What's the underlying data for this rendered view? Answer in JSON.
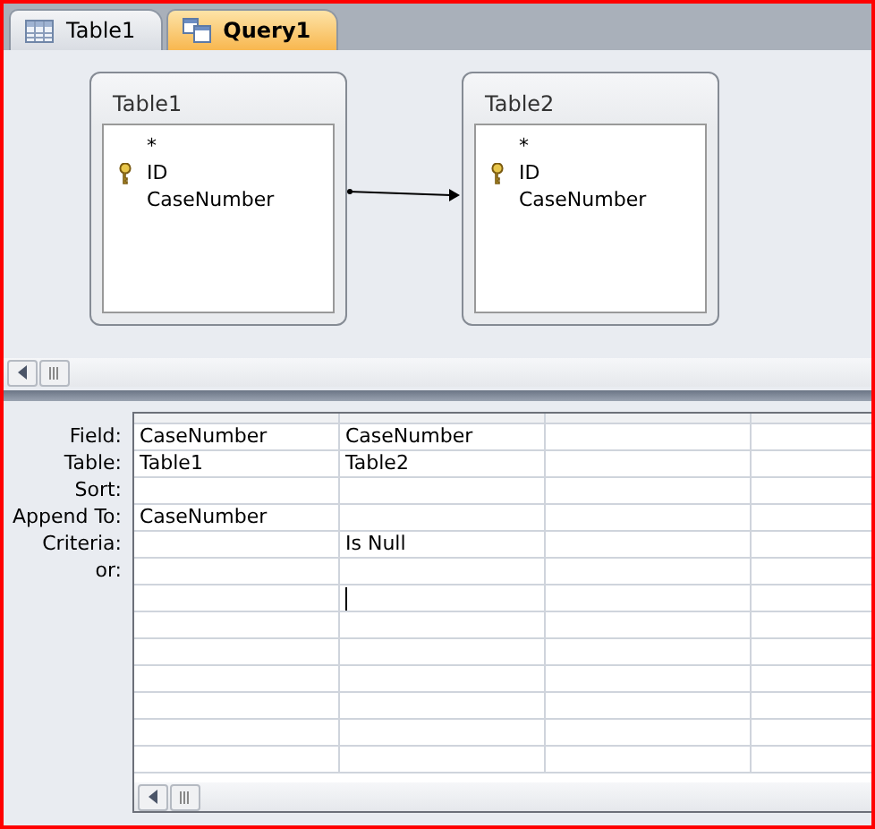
{
  "tabs": [
    {
      "label": "Table1",
      "kind": "table",
      "selected": false
    },
    {
      "label": "Query1",
      "kind": "query",
      "selected": true
    }
  ],
  "field_lists": [
    {
      "title": "Table1",
      "fields": [
        {
          "name": "*",
          "key": false
        },
        {
          "name": "ID",
          "key": true
        },
        {
          "name": "CaseNumber",
          "key": false
        }
      ]
    },
    {
      "title": "Table2",
      "fields": [
        {
          "name": "*",
          "key": false
        },
        {
          "name": "ID",
          "key": true
        },
        {
          "name": "CaseNumber",
          "key": false
        }
      ]
    }
  ],
  "grid": {
    "rows": [
      {
        "label": "Field:",
        "cells": [
          {
            "text": "CaseNumber"
          },
          {
            "text": "CaseNumber"
          },
          {},
          {}
        ]
      },
      {
        "label": "Table:",
        "cells": [
          {
            "text": "Table1"
          },
          {
            "text": "Table2"
          },
          {},
          {}
        ]
      },
      {
        "label": "Sort:",
        "cells": [
          {},
          {},
          {},
          {}
        ]
      },
      {
        "label": "Append To:",
        "cells": [
          {
            "text": "CaseNumber"
          },
          {},
          {},
          {}
        ]
      },
      {
        "label": "Criteria:",
        "cells": [
          {},
          {
            "text": "Is Null"
          },
          {},
          {}
        ]
      },
      {
        "label": "or:",
        "cells": [
          {},
          {},
          {},
          {}
        ]
      },
      {
        "cells": [
          {},
          {
            "editing": true
          },
          {},
          {}
        ]
      }
    ]
  }
}
